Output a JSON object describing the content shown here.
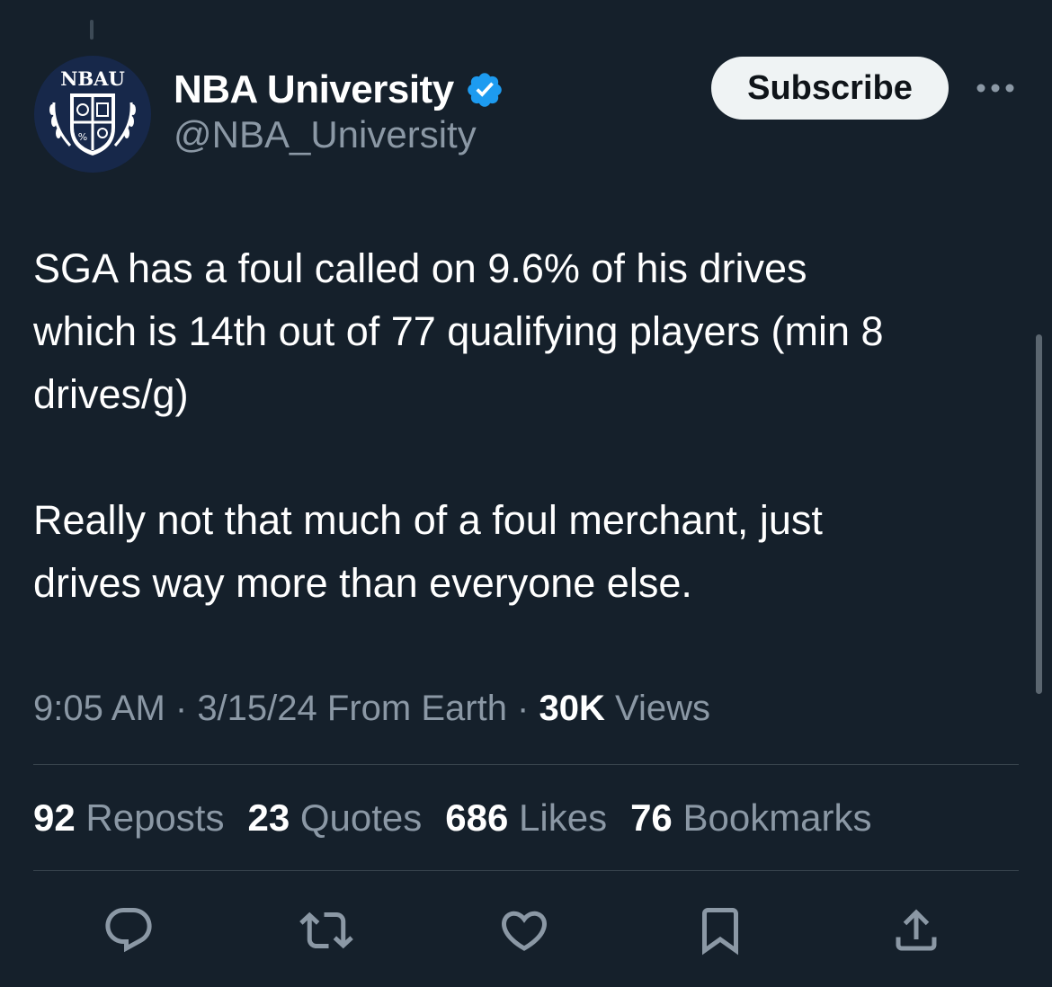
{
  "account": {
    "display_name": "NBA University",
    "handle": "@NBA_University",
    "avatar_icon": "nbau-crest-logo",
    "avatar_text": "NBAU",
    "verified_icon": "verified-badge-icon"
  },
  "header": {
    "subscribe_label": "Subscribe",
    "more_icon": "more-options-icon"
  },
  "tweet": {
    "paragraphs": [
      "SGA has a foul called on 9.6% of his drives\nwhich is 14th out of 77 qualifying players (min 8\ndrives/g)",
      "Really not that much of a foul merchant, just\ndrives way more than everyone else."
    ]
  },
  "meta": {
    "time": "9:05 AM",
    "sep1": " · ",
    "date": "3/15/24",
    "source": " From Earth",
    "sep2": " · ",
    "views_count": "30K",
    "views_label": " Views"
  },
  "stats": [
    {
      "count": "92",
      "label": " Reposts"
    },
    {
      "count": "23",
      "label": " Quotes"
    },
    {
      "count": "686",
      "label": " Likes"
    },
    {
      "count": "76",
      "label": " Bookmarks"
    }
  ],
  "actions": {
    "reply_icon": "reply-icon",
    "repost_icon": "repost-icon",
    "like_icon": "like-icon",
    "bookmark_icon": "bookmark-icon",
    "share_icon": "share-icon"
  },
  "colors": {
    "background": "#15202b",
    "text_primary": "#ffffff",
    "text_secondary": "#8b98a5",
    "divider": "#38444d",
    "verified_blue": "#1d9bf0",
    "subscribe_bg": "#eff3f4"
  }
}
